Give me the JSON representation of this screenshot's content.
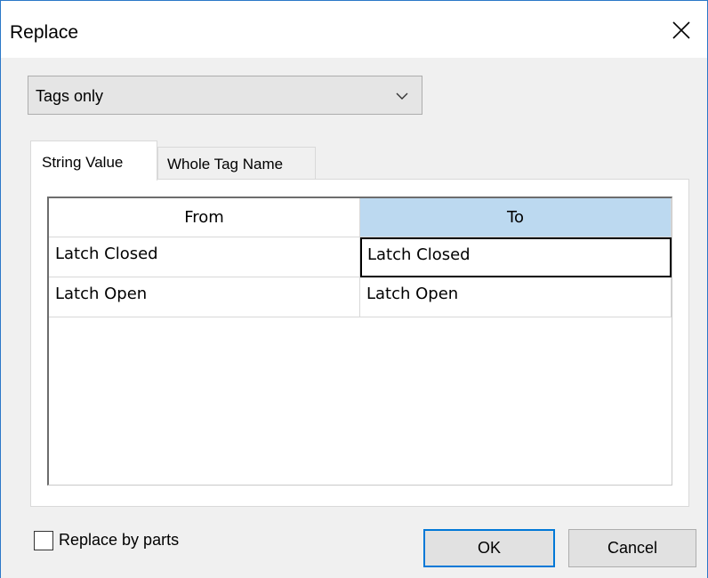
{
  "window": {
    "title": "Replace"
  },
  "scope_dropdown": {
    "selected": "Tags only"
  },
  "tabs": [
    {
      "label": "String Value",
      "active": true
    },
    {
      "label": "Whole Tag Name",
      "active": false
    }
  ],
  "grid": {
    "columns": [
      "From",
      "To"
    ],
    "rows": [
      {
        "from": "Latch Closed",
        "to": "Latch Closed"
      },
      {
        "from": "Latch Open",
        "to": "Latch Open"
      }
    ],
    "selected_cell": {
      "row": 0,
      "column": "To"
    }
  },
  "options": {
    "replace_by_parts_label": "Replace by parts",
    "replace_by_parts_checked": false
  },
  "buttons": {
    "ok_label": "OK",
    "cancel_label": "Cancel"
  },
  "colors": {
    "accent": "#0078d7",
    "header_highlight": "#bcd9f0",
    "window_border": "#2b78c8"
  }
}
